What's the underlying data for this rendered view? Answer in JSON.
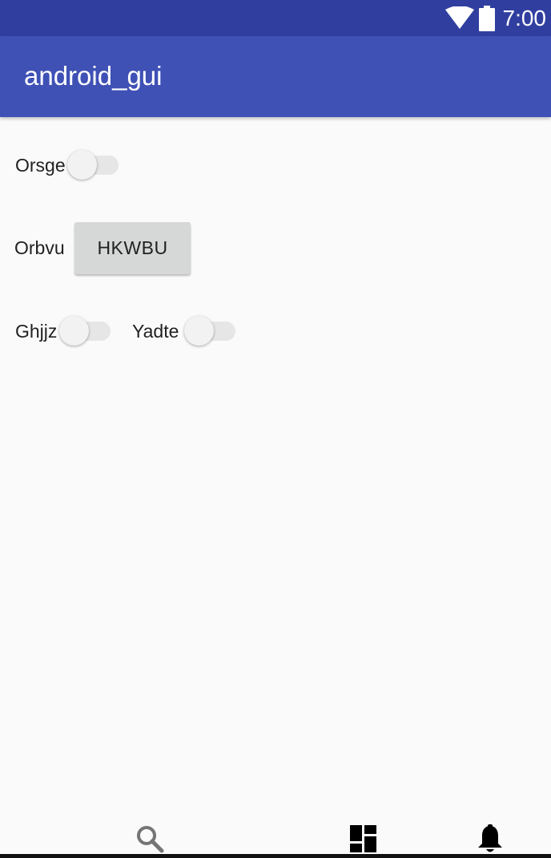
{
  "status_bar": {
    "time": "7:00",
    "background": "#303f9f",
    "icons": [
      "wifi-icon",
      "battery-icon"
    ]
  },
  "app_bar": {
    "title": "android_gui",
    "background": "#3f51b5"
  },
  "form": {
    "switch_orsge": {
      "label": "Orsge",
      "checked": false
    },
    "orbvu": {
      "label": "Orbvu",
      "button_label": "HKWBU"
    },
    "switch_ghjjz": {
      "label": "Ghjjz",
      "checked": false
    },
    "switch_yadte": {
      "label": "Yadte",
      "checked": false
    }
  },
  "bottom_nav": {
    "icons": [
      "search-icon",
      "dashboard-icon",
      "notifications-icon"
    ]
  }
}
